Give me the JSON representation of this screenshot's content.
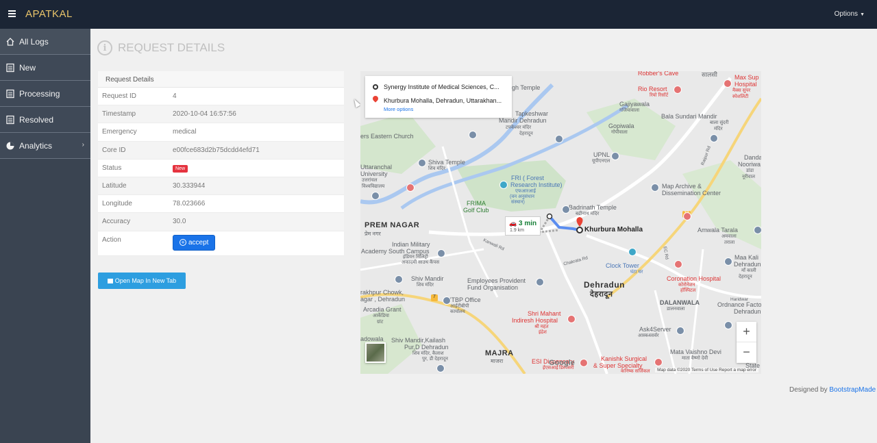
{
  "header": {
    "brand": "APATKAL",
    "options_label": "Options"
  },
  "sidebar": {
    "items": [
      {
        "label": "All Logs",
        "icon": "home-icon"
      },
      {
        "label": "New",
        "icon": "document-icon"
      },
      {
        "label": "Processing",
        "icon": "document-icon"
      },
      {
        "label": "Resolved",
        "icon": "document-icon"
      },
      {
        "label": "Analytics",
        "icon": "pie-chart-icon"
      }
    ]
  },
  "page": {
    "title": "REQUEST DETAILS"
  },
  "details": {
    "heading": "Request Details",
    "rows": [
      {
        "label": "Request ID",
        "value": "4"
      },
      {
        "label": "Timestamp",
        "value": "2020-10-04 16:57:56"
      },
      {
        "label": "Emergency",
        "value": "medical"
      },
      {
        "label": "Core ID",
        "value": "e00fce683d2b75dcdd4efd71"
      },
      {
        "label": "Status",
        "value": "New"
      },
      {
        "label": "Latitude",
        "value": "30.333944"
      },
      {
        "label": "Longitude",
        "value": "78.023666"
      },
      {
        "label": "Accuracy",
        "value": "30.0"
      },
      {
        "label": "Action",
        "value": "accept"
      }
    ]
  },
  "open_map_label": "Open Map In New Tab",
  "map": {
    "origin": "Synergy Institute of Medical Sciences, C...",
    "destination": "Khurbura Mohalla, Dehradun, Uttarakhan...",
    "more_options": "More options",
    "route_time": "3 min",
    "route_distance": "1.9 km",
    "destination_label": "Khurbura Mohalla",
    "labels": {
      "robbers": "Robber's Cave",
      "hindi1": "सालसी",
      "rio": "Rio Resort",
      "rio_hi": "रियो रिसॉर्ट",
      "maxsup": "Max Sup",
      "hospital": "Hospital",
      "maxhi": "मैक्स सुपर",
      "maxhi2": "स्पेशलिटी",
      "htemple": "gh Temple",
      "gajiyawala": "Gajiyawala",
      "gajhi": "गजियावाला",
      "bsm": "Bala Sundari Mandir",
      "bsm_hi": "बाला सुंदरी",
      "bsm_hi2": "मंदिर",
      "church": "ers Eastern Church",
      "tap": "Tapkeshwar",
      "tap2": "Mandir Dehradun",
      "tap_hi": "टपकेश्वर मंदिर",
      "tap_hi2": "देहरादून",
      "gopiwala": "Gopiwala",
      "gopi_hi": "गोपीवाला",
      "upnl": "UPNL",
      "upnl_hi": "यूपीएनएल",
      "danda": "Danda",
      "danda2": "Nooriwa",
      "danda_hi": "डांडा",
      "danda_hi2": "नूरीवाल",
      "shiva": "Shiva Temple",
      "shiva_hi": "शिव मंदिर",
      "uttaranchal": "Uttaranchal",
      "univ": "University",
      "univ_hi": "उत्तरांचल",
      "univ_hi2": "विश्वविद्यालय",
      "fri": "FRI ( Forest",
      "fri2": "Research Institute)",
      "fri_hi": "एफआरआई",
      "fri_hi2": "(वन अनुसंधान",
      "fri_hi3": "संस्थान)",
      "frima": "FRIMA",
      "golf": "Golf Club",
      "mapar": "Map Archive &",
      "mapar2": "Dissemination Center",
      "badrinath": "Badrinath Temple",
      "badri_hi": "बद्रीनाथ मंदिर",
      "prem": "PREM NAGAR",
      "prem_hi": "प्रेम नगर",
      "amwala": "Amwala Tarala",
      "amwala_hi": "अमवाला",
      "amwala_hi2": "तराला",
      "ima": "Indian Military",
      "ima2": "Academy South Campus",
      "ima_hi": "इंडियन मिलिट्री",
      "ima_hi2": "अकादमी साउथ कैंपस",
      "clock": "Clock Tower",
      "clock_hi": "घंटा घर",
      "maakali": "Maa Kali",
      "maakali2": "Dehradun",
      "maakali_hi": "माँ काली",
      "maakali_hi2": "देहरादून",
      "shivm": "Shiv Mandir",
      "shivm_hi": "शिव मंदिर",
      "epf": "Employees Provident",
      "epf2": "Fund Organisation",
      "dehradun": "Dehradun",
      "dehradun_hi": "देहरादून",
      "coronation": "Coronation Hospital",
      "coronation_hi": "कोरोनेशन",
      "coronation_hi2": "हॉस्पिटल",
      "garhi": "rakhpur Chowk,",
      "garhi2": "agar , Dehradun",
      "itbp": "ITBP Office",
      "itbp_hi": "आईटीबीपी",
      "itbp_hi2": "कार्यालय",
      "dalan": "DALANWALA",
      "dalan_hi": "डालनवाला",
      "ordnance": "Ordnance Facto",
      "ordnance2": "Dehradun",
      "arcadia": "Arcadia Grant",
      "arcadia_hi": "आर्केडिया",
      "arcadia_hi2": "ग्रांट",
      "mahant": "Shri Mahant",
      "mahant2": "Indiresh Hospital",
      "mahant_hi": "श्री महंत",
      "mahant_hi2": "इंद्रेश",
      "ask4": "Ask4Server",
      "ask4_hi": "आस्क4सर्वर",
      "badowala": "adowala",
      "shivkailash": "Shiv Mandir,Kailash",
      "shivkailash2": "Pur,D Dehradun",
      "shivk_hi": "शिव मंदिर, कैलाश",
      "shivk_hi2": "पुर, डी देहरादून",
      "majra": "MAJRA",
      "majra_hi": "माजरा",
      "esi": "ESI Dispensary",
      "esi_hi": "ईएसआई",
      "esi_hi2": "डिस्पेंसरी",
      "kanishk": "Kanishk Surgical",
      "kanishk2": "& Super Specialty",
      "kanishk_hi": "कनिष्क सर्जिकल",
      "mata": "Mata Vaishno Devi",
      "mata_hi": "माता वैष्णो देवी",
      "state": "State",
      "kanwali": "Kanwali Rd",
      "chakrata": "Chakrata Rd",
      "raipur": "Raipur Rd",
      "ec": "EC Rd",
      "haridwar": "Haridwar"
    },
    "road_badge_1": "72",
    "road_badge_2": "7",
    "google_label": "Google",
    "attribution": "Map data ©2020   Terms of Use   Report a map error",
    "zoom_in": "+",
    "zoom_out": "−"
  },
  "footer": {
    "prefix": "Designed by ",
    "link": "BootstrapMade"
  }
}
